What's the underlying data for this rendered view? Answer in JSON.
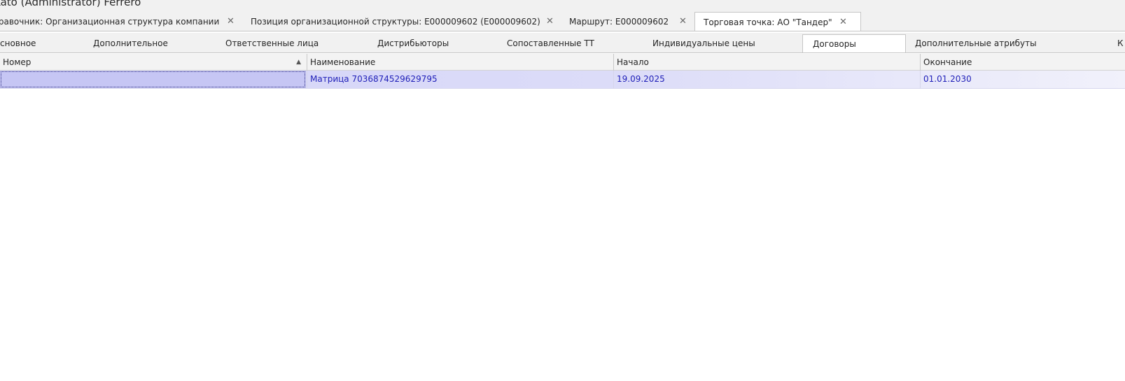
{
  "window": {
    "title": "Kato (Administrator) Ferrero"
  },
  "doc_tabs": [
    {
      "label": "правочник: Организационная структура компании",
      "close": "✕"
    },
    {
      "label": "Позиция организационной структуры: E000009602 (E000009602)",
      "close": "✕"
    },
    {
      "label": "Маршрут: E000009602",
      "close": "✕"
    },
    {
      "label": "Торговая точка: АО \"Тандер\"",
      "close": "✕"
    }
  ],
  "page_tabs": [
    {
      "label": "сновное"
    },
    {
      "label": "Дополнительное"
    },
    {
      "label": "Ответственные лица"
    },
    {
      "label": "Дистрибьюторы"
    },
    {
      "label": "Сопоставленные ТТ"
    },
    {
      "label": "Индивидуальные цены"
    },
    {
      "label": "Договоры"
    },
    {
      "label": "Дополнительные атрибуты"
    },
    {
      "label": "К"
    }
  ],
  "grid": {
    "columns": [
      {
        "label": "Номер",
        "sort": "▲"
      },
      {
        "label": "Наименование"
      },
      {
        "label": "Начало"
      },
      {
        "label": "Окончание"
      }
    ],
    "rows": [
      {
        "number": "",
        "name": "Матрица 7036874529629795",
        "start": "19.09.2025",
        "end": "01.01.2030"
      }
    ]
  },
  "colors": {
    "selected_row": "#d3d3f9",
    "link_text": "#1f1fb8",
    "tab_bar": "#f1f1f1"
  }
}
